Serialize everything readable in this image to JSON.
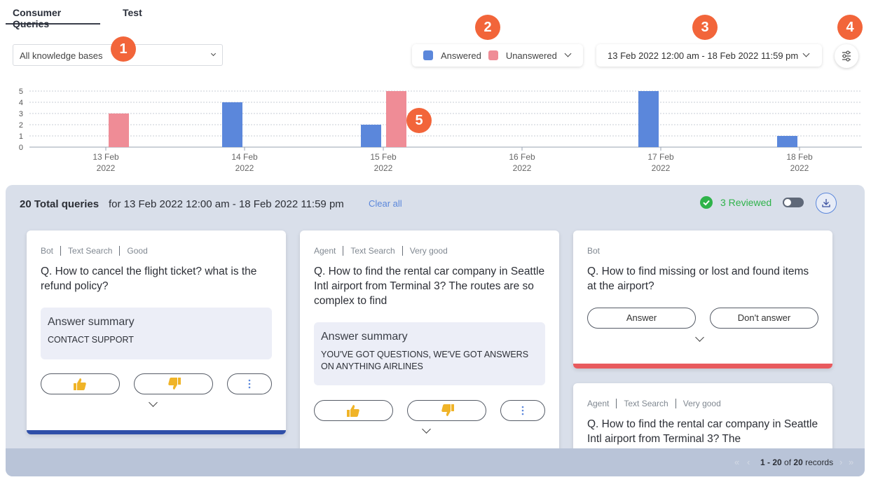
{
  "tabs": [
    {
      "label": "Consumer Queries",
      "active": true
    },
    {
      "label": "Test",
      "active": false
    }
  ],
  "kb_select": {
    "value": "All knowledge bases"
  },
  "badges": [
    "1",
    "2",
    "3",
    "4",
    "5"
  ],
  "legend": {
    "answered": "Answered",
    "unanswered": "Unanswered"
  },
  "date_range": {
    "value": "13 Feb 2022 12:00 am - 18 Feb 2022 11:59 pm"
  },
  "colors": {
    "answered": "#5b87db",
    "unanswered": "#ef8c96",
    "accent": "#f2653a",
    "reviewed": "#2fb34a",
    "card_blue": "#2f4fa8",
    "card_red": "#e85a5e"
  },
  "chart_data": {
    "type": "bar",
    "categories": [
      "13 Feb 2022",
      "14 Feb 2022",
      "15 Feb 2022",
      "16 Feb 2022",
      "17 Feb 2022",
      "18 Feb 2022"
    ],
    "tick_lines": [
      [
        "13 Feb",
        "2022"
      ],
      [
        "14 Feb",
        "2022"
      ],
      [
        "15 Feb",
        "2022"
      ],
      [
        "16 Feb",
        "2022"
      ],
      [
        "17 Feb",
        "2022"
      ],
      [
        "18 Feb",
        "2022"
      ]
    ],
    "series": [
      {
        "name": "Answered",
        "values": [
          0,
          4,
          2,
          0,
          5,
          1
        ]
      },
      {
        "name": "Unanswered",
        "values": [
          3,
          0,
          5,
          0,
          0,
          0
        ]
      }
    ],
    "yticks": [
      "0",
      "1",
      "2",
      "3",
      "4",
      "5"
    ],
    "ylim": [
      0,
      5
    ],
    "grid": true
  },
  "summary": {
    "total": "20 Total queries",
    "range": "for 13 Feb 2022 12:00 am - 18 Feb 2022 11:59 pm",
    "clear_all": "Clear all",
    "reviewed": "3 Reviewed"
  },
  "cards": [
    {
      "tags": [
        "Bot",
        "Text Search",
        "Good"
      ],
      "question": "Q. How to cancel the flight ticket? what is the refund policy?",
      "summary_title": "Answer summary",
      "summary_text": "CONTACT SUPPORT"
    },
    {
      "tags": [
        "Agent",
        "Text Search",
        "Very good"
      ],
      "question": "Q. How to find the rental car company in Seattle Intl airport from Terminal 3? The routes are so complex to find",
      "summary_title": "Answer summary",
      "summary_text": "YOU'VE GOT QUESTIONS, WE'VE GOT ANSWERS ON ANYTHING AIRLINES"
    },
    {
      "tags": [
        "Bot"
      ],
      "question": "Q. How to find missing or lost and found items at the airport?",
      "answer_label": "Answer",
      "dont_answer_label": "Don't answer"
    },
    {
      "tags": [
        "Agent",
        "Text Search",
        "Very good"
      ],
      "question": "Q. How to find the rental car company in Seattle Intl airport from Terminal 3? The"
    }
  ],
  "pagination": {
    "range": "1 - 20",
    "of": "of",
    "total": "20",
    "records": "records"
  }
}
